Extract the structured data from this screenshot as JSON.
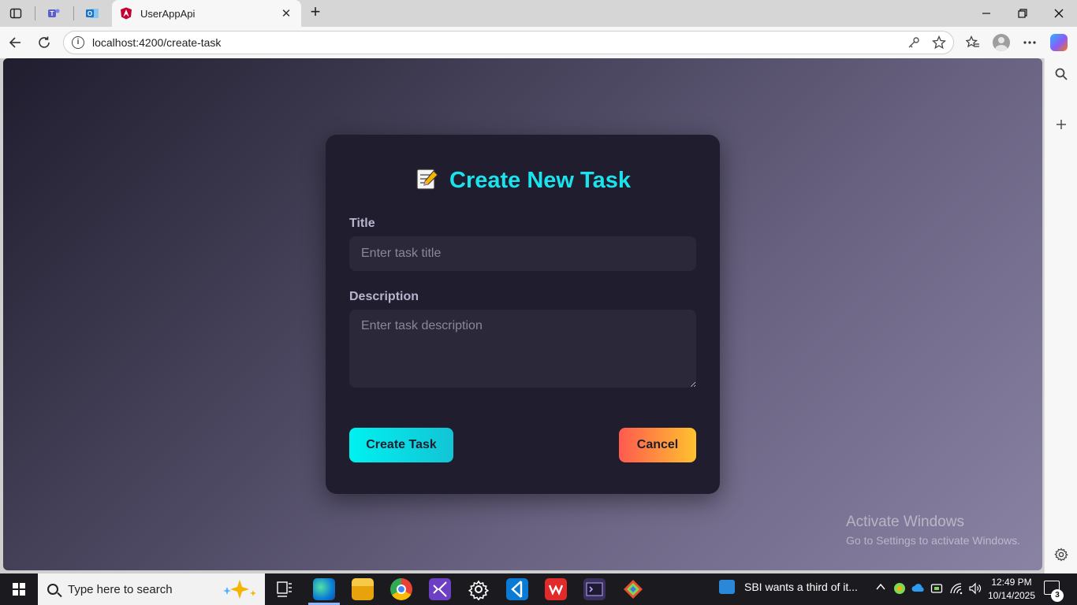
{
  "browser": {
    "tab": {
      "title": "UserAppApi",
      "close": "✕"
    },
    "new_tab": "+",
    "address": {
      "url": "localhost:4200/create-task"
    }
  },
  "form": {
    "title": "Create New Task",
    "title_label": "Title",
    "title_placeholder": "Enter task title",
    "description_label": "Description",
    "description_placeholder": "Enter task description",
    "create_button": "Create Task",
    "cancel_button": "Cancel"
  },
  "watermark": {
    "line1": "Activate Windows",
    "line2": "Go to Settings to activate Windows."
  },
  "taskbar": {
    "search_placeholder": "Type here to search",
    "news_text": "SBI wants a third of it...",
    "time": "12:49 PM",
    "date": "10/14/2025",
    "notification_count": "3"
  },
  "colors": {
    "accent_title": "#1ae3ee",
    "create_gradient": [
      "#00f1f0",
      "#13c4d6"
    ],
    "cancel_gradient": [
      "#ff5a4f",
      "#ffc22e"
    ],
    "card_bg": "#1f1d2e"
  }
}
